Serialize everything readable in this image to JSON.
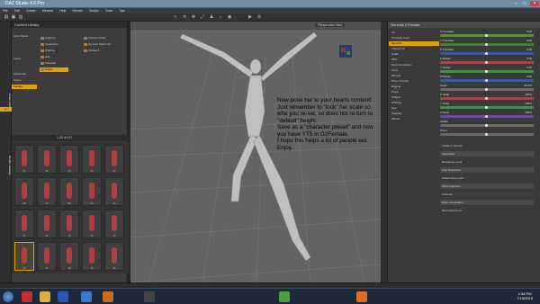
{
  "window": {
    "title": "DAZ Studio 4.6 Pro"
  },
  "menu": [
    "File",
    "Edit",
    "Create",
    "Window",
    "Help",
    "Render",
    "Scripts",
    "Tools",
    "Tips"
  ],
  "left_panel": {
    "tabs": [
      "Smart Content",
      "Content Library",
      "Render Settings"
    ],
    "tree": [
      "Actor Packs",
      "Laura",
      "G2Female",
      "Poses",
      "Female"
    ],
    "folders": [
      "Anatomy",
      "Characters",
      "Clothing",
      "Hair",
      "Materials",
      "Poses",
      "Camera Tricks",
      "Genesis Starter Kit",
      "Victoria 6"
    ],
    "selected_folder": "Poses",
    "page_label": "1-25 of 117",
    "thumbs": [
      "01",
      "02",
      "03",
      "04",
      "05",
      "06",
      "07",
      "08",
      "09",
      "10",
      "11",
      "12",
      "13",
      "14",
      "15",
      "16",
      "17",
      "18",
      "19",
      "20"
    ]
  },
  "viewport": {
    "camera": "Perspective View",
    "note": "Now pose her to your hearts content!\nJust remember to \"lock\" her scale so whe you re-set, so does not re-turn to \"default\" height.\nSave as a \"character preset\" and now you have YT5 in G2Female.\nI hope this helps a lot of people out. Enjoy."
  },
  "right_panel": {
    "header": "Genesis 2 Female",
    "groups": [
      "All",
      "Currently Used",
      "General",
      "Transforms",
      "Scale",
      "Misc",
      "Mesh Resolution",
      "Actor",
      "Morphs",
      "Pose Controls",
      "Rigging",
      "Props",
      "Shapes",
      "Clothing",
      "Hair",
      "Shaping",
      "ZBrush"
    ],
    "selected_group": "General",
    "params": [
      {
        "label": "X Translate",
        "value": "0.00",
        "color": "#5a8a3a"
      },
      {
        "label": "Y Translate",
        "value": "0.00",
        "color": "#4a7a3a"
      },
      {
        "label": "Z Translate",
        "value": "0.00",
        "color": "#3a5a8a"
      },
      {
        "label": "X Rotate",
        "value": "0.00",
        "color": "#a04848"
      },
      {
        "label": "Y Rotate",
        "value": "0.00",
        "color": "#4a8a4a"
      },
      {
        "label": "Z Rotate",
        "value": "0.00",
        "color": "#3a5a9a"
      },
      {
        "label": "Scale",
        "value": "96.0%",
        "color": "#6a6a6a"
      },
      {
        "label": "X Scale",
        "value": "100%",
        "color": "#a04848"
      },
      {
        "label": "Y Scale",
        "value": "100%",
        "color": "#4a8a4a"
      },
      {
        "label": "Z Scale",
        "value": "100%",
        "color": "#6a4a9a"
      },
      {
        "label": "Visible",
        "value": "",
        "color": "#6a6a6a"
      },
      {
        "label": "Show",
        "value": "",
        "color": "#6a6a6a"
      }
    ],
    "lower": [
      "Visible in Render",
      "Selectable",
      "Resolution Level",
      "High Resolution",
      "SubDivision Level",
      "SubD Algorithm",
      "Catmark",
      "Edge Interpolation",
      "Show Sub Items"
    ]
  },
  "taskbar": {
    "time": "1:34 PM",
    "date": "7/19/2013"
  },
  "colors": {
    "accent": "#e0a000",
    "viewport": "#636363",
    "title": "#6f8fa8"
  }
}
